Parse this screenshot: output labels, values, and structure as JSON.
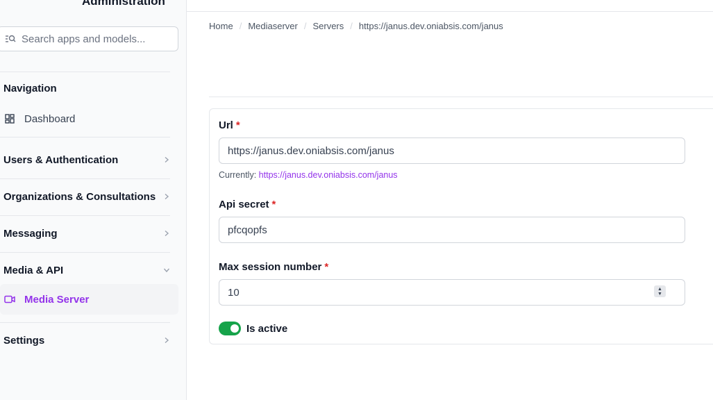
{
  "app": {
    "title": "Administration"
  },
  "search": {
    "placeholder": "Search apps and models..."
  },
  "sidebar": {
    "navigation_label": "Navigation",
    "dashboard_label": "Dashboard",
    "groups": [
      {
        "label": "Users & Authentication",
        "expanded": false
      },
      {
        "label": "Organizations & Consultations",
        "expanded": false
      },
      {
        "label": "Messaging",
        "expanded": false
      },
      {
        "label": "Media & API",
        "expanded": true
      },
      {
        "label": "Settings",
        "expanded": false
      }
    ],
    "media_server_label": "Media Server"
  },
  "breadcrumb": [
    "Home",
    "Mediaserver",
    "Servers",
    "https://janus.dev.oniabsis.com/janus"
  ],
  "form": {
    "url": {
      "label": "Url",
      "required_mark": "*",
      "value": "https://janus.dev.oniabsis.com/janus",
      "currently_prefix": "Currently:",
      "currently_link": "https://janus.dev.oniabsis.com/janus"
    },
    "api_secret": {
      "label": "Api secret",
      "required_mark": "*",
      "value": "pfcqopfs"
    },
    "max_session": {
      "label": "Max session number",
      "required_mark": "*",
      "value": "10"
    },
    "is_active": {
      "label": "Is active",
      "checked": true
    }
  },
  "colors": {
    "accent": "#9333ea",
    "toggle_on": "#16a34a",
    "required": "#dc2626"
  },
  "icons": {
    "search": "search-icon",
    "dashboard": "dashboard-grid-icon",
    "media_server": "video-camera-icon",
    "chevron_right": "chevron-right-icon",
    "chevron_down": "chevron-down-icon"
  }
}
